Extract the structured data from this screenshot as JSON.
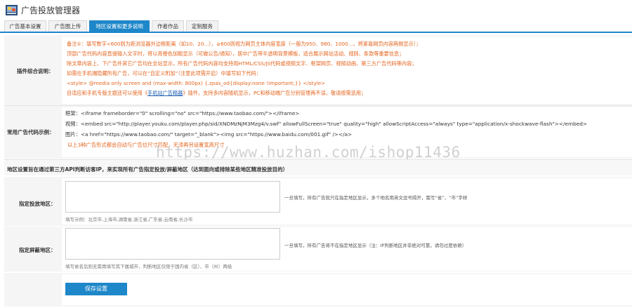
{
  "app": {
    "title": "广告投放管理器"
  },
  "tabs": [
    {
      "label": "广告基本设置"
    },
    {
      "label": "广告图上传"
    },
    {
      "label": "地区设置和更多说明"
    },
    {
      "label": "作者作品"
    },
    {
      "label": "定制服务"
    }
  ],
  "plugin_notes": {
    "label": "插件综合说明：",
    "lines": [
      "备注①：填写数字<600则为距浏览器外边框距离（如10、20...），≥600则视为网页主体内容宽度（一般为950、980、1000...，将紧靠网页内容两侧显示）；",
      "顶部广告代码内容直接输入文字时，将以亮橙色加粗显示（可做公告/通知），居中广告带半透明背景模板，适合展示网站活动、规则、条款等重要信息；",
      "除文章内容上、下广告外其它广告均在全站显示，所有广告代码内容均支持用HTML/CSS/JS代码或视频文字、框架网页、视频动画、第三方广告代码等内容；",
      "如需在手机端隐藏所有广告，可以在“自定义附加”（注意此项需开启）中填写如下代码：",
      "<style> @media only screen and (max-width: 800px) {.zpas_od{display:none !important;}} </style>",
      "自适应和手机专版主题还可以使用《手机站广告精器》插件，支持多内容随机显示，PC和移动端广告分别管理两不误，敬请按需选用；"
    ],
    "link_text": "手机站广告精器"
  },
  "code_examples": {
    "label": "常用广告代码示例：",
    "frame": "框架：<iframe frameborder=\"0\" scrolling=\"no\" src=\"https://www.taobao.com/\"></iframe>",
    "video": "视频：<embed src=\"http://player.youku.com/player.php/sid/XNDMzNjM3Mzg4/v.swf\" allowFullScreen=\"true\" quality=\"high\" allowScriptAccess=\"always\" type=\"application/x-shockwave-flash\"></embed>",
    "image": "图片：<a href=\"https://www.taobao.com/\" target=\"_blank\"><img src=\"https://www.baidu.com/001.gif\" /></a>",
    "note": "以上3种广告形式都会自动与广告位尺寸匹配，无须再另设置宽高尺寸"
  },
  "watermark": "https://www.huzhan.com/ishop11436",
  "region": {
    "heading": "地区设置旨在通过第三方API判断访客IP，来实现所有广告指定投放/屏蔽地区（达到面向或排除某些地区精准投放目的）",
    "target_label": "指定投放地区：",
    "target_value": "",
    "target_hint": "一旦填写，所有广告就只在指定地区显示，多个地名用英文逗号隔开，需写“省”、“市”字样",
    "target_example": "填写示例：北京市,上海市,湖南省,浙江省,广东省,云南省,长沙市",
    "block_label": "指定屏蔽地区：",
    "block_value": "",
    "block_hint": "一旦填写，所有广告将不在指定地区显示（注：IP判断地区并非绝对可靠，请勿过度依赖）",
    "block_example": "填写省名后则无需再填写其下属城市，判断地区仅限于国内省（区）、市（州）两级"
  },
  "save_button": "保存设置",
  "colors": {
    "accent": "#1e87c9",
    "note": "#e4651f",
    "link": "#1e5fb5"
  }
}
